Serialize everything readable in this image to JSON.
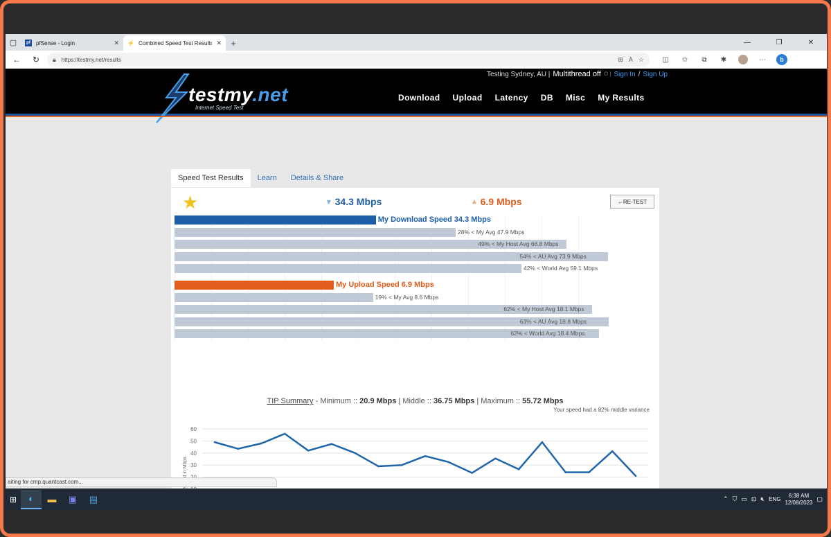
{
  "browser": {
    "tabs": [
      {
        "label": "pfSense - Login",
        "active": false
      },
      {
        "label": "Combined Speed Test Results",
        "active": true
      }
    ],
    "url": "https://testmy.net/results",
    "new_tab": "+",
    "window_controls": [
      "—",
      "❐",
      "✕"
    ]
  },
  "site": {
    "top_location": "Testing Sydney, AU |",
    "multithread": "Multithread off",
    "sign_in": "Sign In",
    "separator": "/",
    "sign_up": "Sign Up",
    "logo_name_a": "testmy",
    "logo_name_b": ".net",
    "logo_sub": "Internet Speed Test",
    "nav": [
      "Download",
      "Upload",
      "Latency",
      "DB",
      "Misc",
      "My Results"
    ]
  },
  "content_tabs": [
    "Speed Test Results",
    "Learn",
    "Details & Share"
  ],
  "results": {
    "download_big": "34.3 Mbps",
    "upload_big": "6.9 Mbps",
    "retest": "←RE-TEST",
    "download_rows": [
      {
        "label": "My Download Speed 34.3 Mbps",
        "value": 34.3,
        "main": true
      },
      {
        "label": "28% < My Avg 47.9 Mbps",
        "value": 47.9
      },
      {
        "label": "49% < My Host Avg 66.8 Mbps",
        "value": 66.8
      },
      {
        "label": "54% < AU Avg 73.9 Mbps",
        "value": 73.9
      },
      {
        "label": "42% < World Avg 59.1 Mbps",
        "value": 59.1
      }
    ],
    "upload_rows": [
      {
        "label": "My Upload Speed 6.9 Mbps",
        "value": 6.9,
        "main": true
      },
      {
        "label": "19% < My Avg 8.6 Mbps",
        "value": 8.6
      },
      {
        "label": "62% < My Host Avg 18.1 Mbps",
        "value": 18.1
      },
      {
        "label": "63% < AU Avg 18.8 Mbps",
        "value": 18.8
      },
      {
        "label": "62% < World Avg 18.4 Mbps",
        "value": 18.4
      }
    ],
    "tip_title": "TIP Summary",
    "tip_min_label": " - Minimum :: ",
    "tip_min": "20.9 Mbps",
    "tip_mid_label": " | Middle :: ",
    "tip_mid": "36.75 Mbps",
    "tip_max_label": " | Maximum :: ",
    "tip_max": "55.72 Mbps",
    "variance": "Your speed had a 82% middle variance"
  },
  "chart_data": {
    "type": "line",
    "ylabel": "Speed in Mbps",
    "xlabel": "",
    "ylim": [
      10,
      60
    ],
    "yticks": [
      10,
      20,
      30,
      40,
      50,
      60
    ],
    "series": [
      {
        "values": [
          49,
          43.5,
          48,
          56,
          42,
          47.5,
          40,
          29,
          30,
          37.5,
          32.5,
          23.5,
          35.5,
          26.5,
          49,
          24,
          24,
          41.5,
          21
        ]
      }
    ],
    "color": "#1f66a8"
  },
  "status_text": "aiting for cmp.quantcast.com...",
  "taskbar": {
    "lang": "ENG",
    "time": "6:38 AM",
    "date": "12/08/2023"
  },
  "colors": {
    "download": "#1d5ea8",
    "upload": "#e05d1c",
    "compare_bar": "#bfcad6",
    "frame": "#f5794a"
  }
}
